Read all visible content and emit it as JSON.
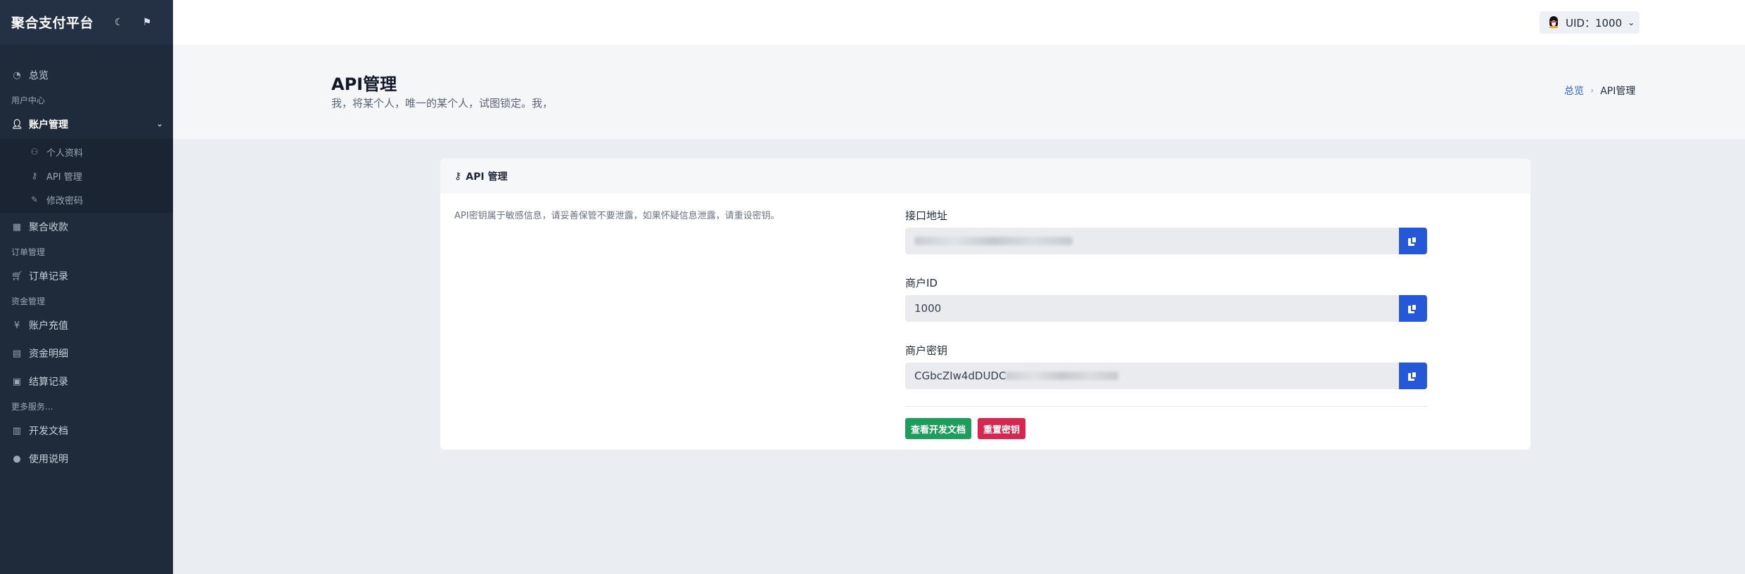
{
  "app": {
    "brand": "聚合支付平台",
    "theme_icon": "moon-icon",
    "notify_icon": "flag-icon"
  },
  "sidebar": {
    "overview": "总览",
    "section_user": "用户中心",
    "account_mgmt": "账户管理",
    "sub_items": [
      "个人资料",
      "API 管理",
      "修改密码"
    ],
    "aggregate_pay": "聚合收款",
    "section_order": "订单管理",
    "order_records": "订单记录",
    "section_funds": "资金管理",
    "recharge": "账户充值",
    "fund_details": "资金明细",
    "settlement": "结算记录",
    "section_more": "更多服务...",
    "dev_docs": "开发文档",
    "usage": "使用说明"
  },
  "topbar": {
    "uid_label": "UID：1000"
  },
  "page": {
    "title": "API管理",
    "subtitle": "我，将某个人，唯一的某个人，试图锁定。我，",
    "breadcrumb_home": "总览",
    "breadcrumb_current": "API管理"
  },
  "card": {
    "title": "API 管理",
    "notice": "API密钥属于敏感信息，请妥善保管不要泄露，如果怀疑信息泄露，请重设密钥。",
    "api_url_label": "接口地址",
    "merchant_id_label": "商户ID",
    "merchant_id_value": "1000",
    "merchant_key_label": "商户密钥",
    "merchant_key_value": "CGbcZIw4dDUDC",
    "view_docs_button": "查看开发文档",
    "reset_key_button": "重置密钥"
  },
  "colors": {
    "sidebar_bg": "#1f2a3a",
    "primary": "#2558d9",
    "success": "#1e9e5c",
    "danger": "#d7264f"
  }
}
